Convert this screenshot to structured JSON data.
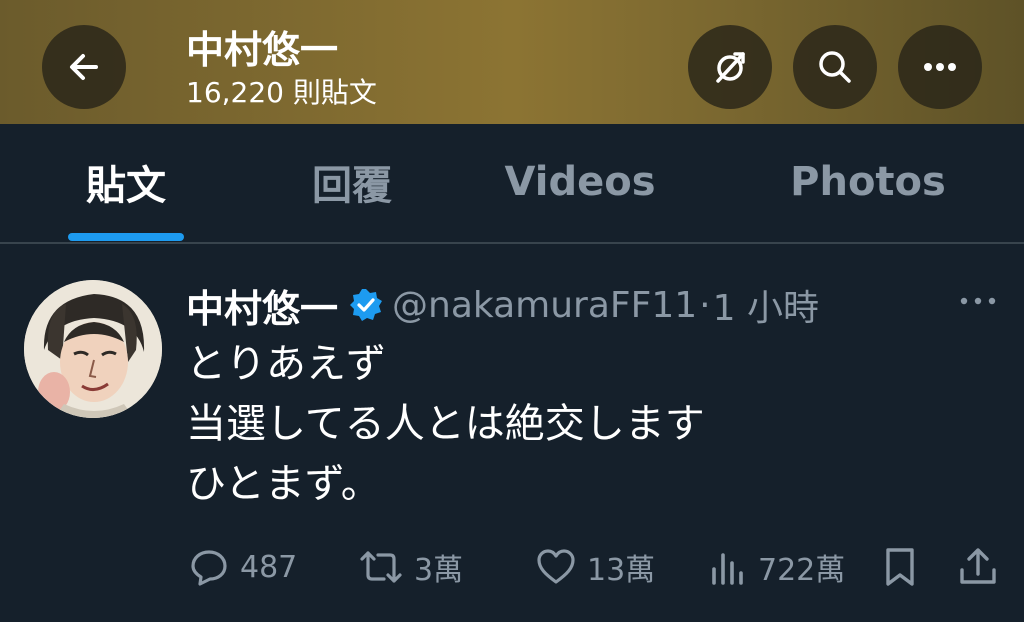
{
  "header": {
    "title": "中村悠一",
    "post_count": "16,220 則貼文",
    "buttons": [
      "back-icon",
      "unfollow-icon",
      "search-icon",
      "more-icon"
    ],
    "colors": {
      "banner": "#8c7433",
      "button_bg": "#282418"
    }
  },
  "tabs": [
    {
      "label": "貼文",
      "active": true
    },
    {
      "label": "回覆",
      "active": false
    },
    {
      "label": "Videos",
      "active": false
    },
    {
      "label": "Photos",
      "active": false
    }
  ],
  "tweet": {
    "author_name": "中村悠一",
    "verified": true,
    "handle": "@nakamuraFF11",
    "separator": "·",
    "time": "1 小時",
    "lines": [
      "とりあえず",
      "当選してる人とは絶交します",
      "ひとまず。"
    ],
    "actions": {
      "replies": "487",
      "retweets": "3萬",
      "likes": "13萬",
      "views": "722萬"
    }
  },
  "colors": {
    "background": "#15202b",
    "accent": "#1d9bf0",
    "muted_text": "#8b98a5",
    "divider": "#38444d"
  }
}
